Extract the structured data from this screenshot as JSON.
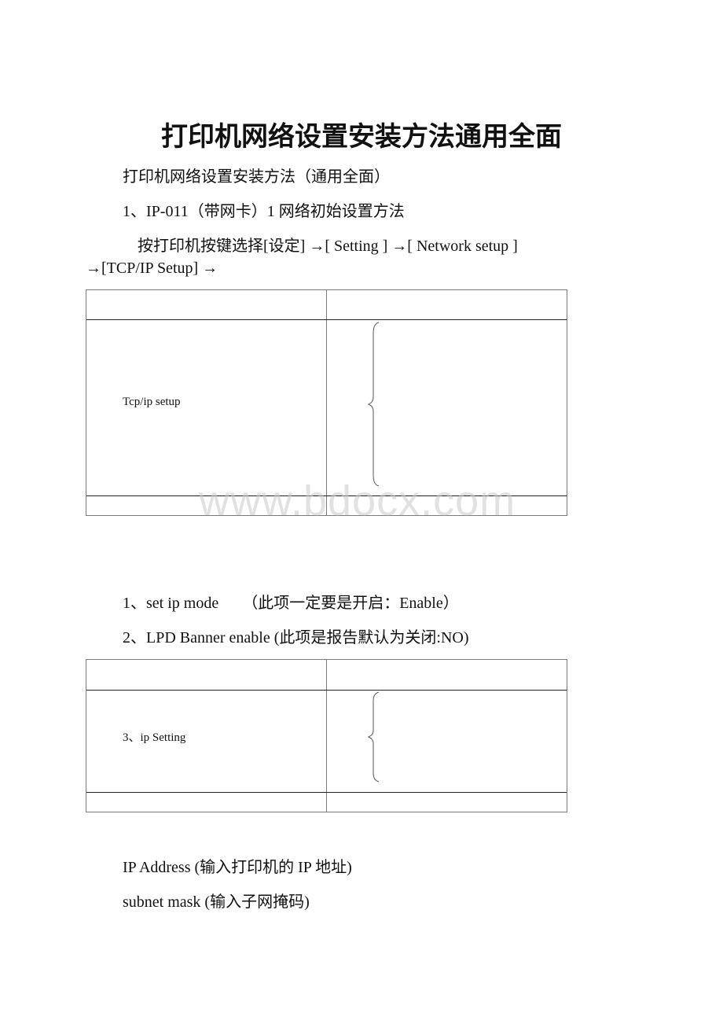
{
  "document": {
    "title": "打印机网络设置安装方法通用全面",
    "paragraphs": {
      "intro": "打印机网络设置安装方法（通用全面）",
      "section1": "1、IP-011（带网卡）1 网络初始设置方法",
      "instruction_line1": "按打印机按键选择[设定] →[ Setting ] →[ Network setup ]",
      "instruction_line2": "→[TCP/IP Setup] →"
    },
    "table1": {
      "header_left": "",
      "header_right": "",
      "body_left": "Tcp/ip setup",
      "body_right": "",
      "footer_left": "",
      "footer_right": ""
    },
    "list": {
      "item1": "1、set ip mode　　（此项一定要是开启：Enable）",
      "item2": "2、LPD Banner enable   (此项是报告默认为关闭:NO)"
    },
    "table2": {
      "header_left": "",
      "header_right": "",
      "body_left": "3、ip Setting",
      "body_right": "",
      "footer_left": "",
      "footer_right": ""
    },
    "fields": {
      "ip_address": "IP Address      (输入打印机的 IP 地址)",
      "subnet_mask": "subnet mask   (输入子网掩码)"
    }
  },
  "watermark": "www.bdocx.com",
  "icons": {
    "brace": "left-curly-brace"
  }
}
